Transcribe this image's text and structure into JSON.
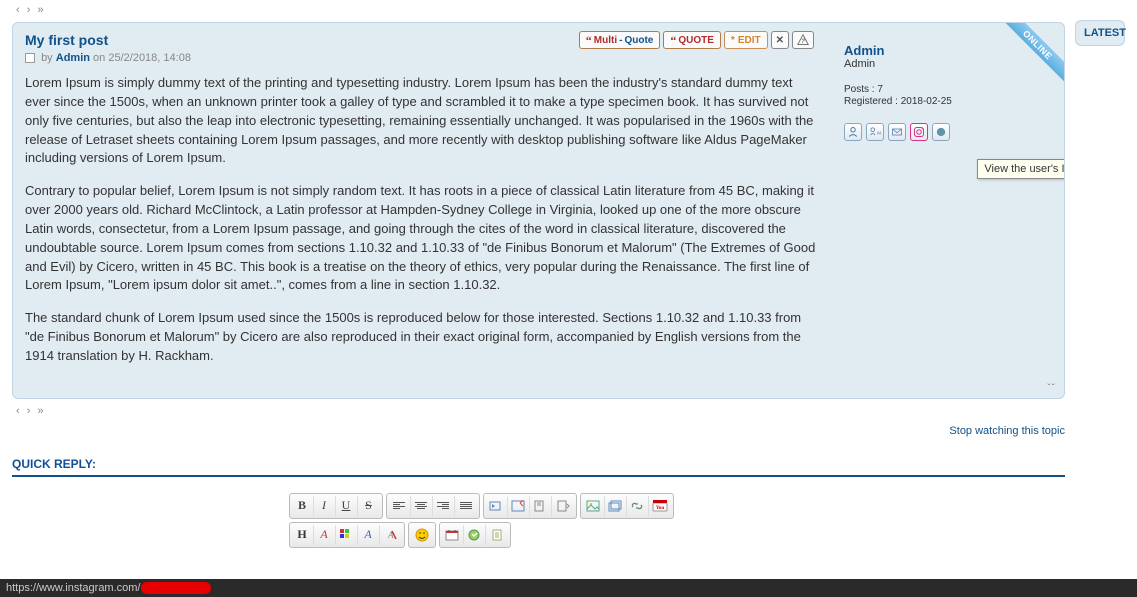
{
  "post": {
    "title": "My first post",
    "by_prefix": "by",
    "author": "Admin",
    "date_prefix": "on",
    "date": "25/2/2018, 14:08",
    "paragraphs": [
      "Lorem Ipsum is simply dummy text of the printing and typesetting industry. Lorem Ipsum has been the industry's standard dummy text ever since the 1500s, when an unknown printer took a galley of type and scrambled it to make a type specimen book. It has survived not only five centuries, but also the leap into electronic typesetting, remaining essentially unchanged. It was popularised in the 1960s with the release of Letraset sheets containing Lorem Ipsum passages, and more recently with desktop publishing software like Aldus PageMaker including versions of Lorem Ipsum.",
      "Contrary to popular belief, Lorem Ipsum is not simply random text. It has roots in a piece of classical Latin literature from 45 BC, making it over 2000 years old. Richard McClintock, a Latin professor at Hampden-Sydney College in Virginia, looked up one of the more obscure Latin words, consectetur, from a Lorem Ipsum passage, and going through the cites of the word in classical literature, discovered the undoubtable source. Lorem Ipsum comes from sections 1.10.32 and 1.10.33 of \"de Finibus Bonorum et Malorum\" (The Extremes of Good and Evil) by Cicero, written in 45 BC. This book is a treatise on the theory of ethics, very popular during the Renaissance. The first line of Lorem Ipsum, \"Lorem ipsum dolor sit amet..\", comes from a line in section 1.10.32.",
      "The standard chunk of Lorem Ipsum used since the 1500s is reproduced below for those interested. Sections 1.10.32 and 1.10.33 from \"de Finibus Bonorum et Malorum\" by Cicero are also reproduced in their exact original form, accompanied by English versions from the 1914 translation by H. Rackham."
    ]
  },
  "actions": {
    "multi": "Multi",
    "multi_sep": " - ",
    "quote_word": "Quote",
    "quote": "QUOTE",
    "edit": "EDIT",
    "delete": "✕",
    "ip": "?"
  },
  "profile": {
    "name": "Admin",
    "rank": "Admin",
    "posts_label": "Posts :",
    "posts_value": "7",
    "reg_label": "Registered :",
    "reg_value": "2018-02-25",
    "online": "ONLINE"
  },
  "tooltip": "View the user's Instagram account",
  "sidebar": {
    "latest": "LATEST"
  },
  "footer_links": {
    "stop_watching": "Stop watching this topic"
  },
  "quick_reply": {
    "header": "QUICK REPLY:"
  },
  "toolbar": {
    "bold": "B",
    "italic": "I",
    "underline": "U",
    "strike": "S",
    "h": "H",
    "a1": "A",
    "a2": "A"
  },
  "status_url": "https://www.instagram.com/"
}
